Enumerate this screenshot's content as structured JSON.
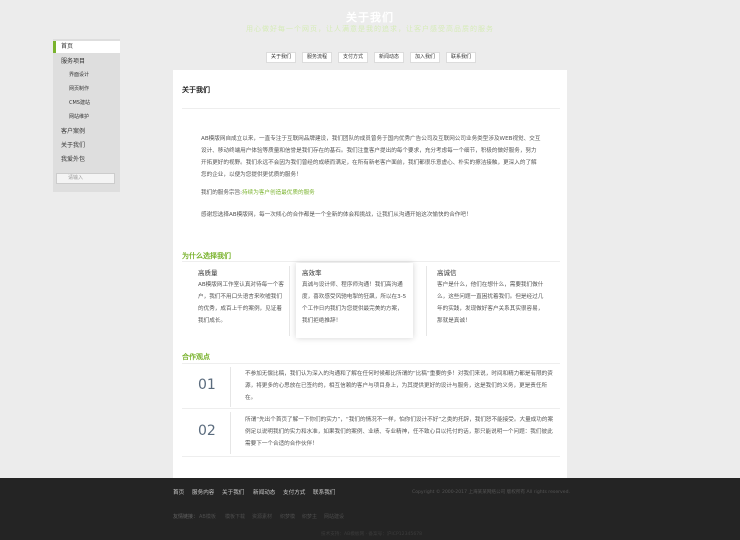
{
  "header": {
    "title": "关于我们",
    "tagline": "用心做好每一个网页，让人满意是我的追求，让客户感受高品质的服务"
  },
  "sidenav": {
    "items": [
      {
        "label": "首页",
        "active": true
      },
      {
        "label": "服务项目"
      },
      {
        "label": "界面设计",
        "sub": true
      },
      {
        "label": "网页制作",
        "sub": true
      },
      {
        "label": "CMS建站",
        "sub": true
      },
      {
        "label": "网站维护",
        "sub": true
      },
      {
        "label": "客户案例"
      },
      {
        "label": "关于我们"
      },
      {
        "label": "我爱外包"
      }
    ],
    "search_placeholder": "请输入"
  },
  "tabs": [
    "关于我们",
    "服务流程",
    "支付方式",
    "新闻动态",
    "加入我们",
    "联系我们"
  ],
  "card": {
    "title": "关于我们",
    "intro": "AB模版网自成立以来，一直专注于互联网品牌建设，我们团队的成员曾务于国内优秀广告公司及互联网公司业务类型涉及WEB视觉、交互设计、移动终端用户体验等质量和信誉是我们存在的基石。我们注重客户提出的每个要求，充分考虑每一个细节，积极的做好服务，努力开拓更好的视野。我们永远不会因为我们曾经的成绩而满足，在所有新老客户面前，我们都很乐意虚心、朴实的擦洁接触，更深入的了解您的企业，以便为您提供更优质的服务！",
    "mission_prefix": "我们的服务宗旨:",
    "mission_highlight": "持续为客户创造最优质的服务",
    "thanks": "感谢您选择AB模版网，每一次倾心的合作都是一个全新的体会和挑战，让我们从沟通开始这次愉快的合作吧！",
    "why_title": "为什么选择我们",
    "features": [
      {
        "title": "高质量",
        "text": "AB模版网工作室认真对待每一个客户，我们不用口头语言来吹嘘我们的优秀，成百上千的案例，见证着我们成长。"
      },
      {
        "title": "高效率",
        "text": "真诚与设计师、程序师沟通！我们高沟通度，喜欢感受风驰电掣的狂飙，所以在3-5个工作日内我们为您提供最完美的方案，我们拒绝推辞！"
      },
      {
        "title": "高诚信",
        "text": "客户是什么，他们在想什么，需要我们做什么，这些问题一直困扰着我们。但是经过几年的实践，发现做好客户关系其实很容易，那就是真诚！"
      }
    ],
    "views_title": "合作观点",
    "views": [
      {
        "num": "01",
        "text": "不参加无偿比稿，我们认为深入的沟通和了解在任何时候都比所谓的“比稿”重要的多！对我们来说，时间和精力都是有限的资源，将更多的心思放在已签约的，相互信赖的客户与项目身上，为其提供更好的设计与服务，这是我们的义务，更是责任所在。"
      },
      {
        "num": "02",
        "text": "所谓“先出个首页了解一下你们的实力”，“我们的情况不一样，怕你们设计不好”之类的托辞，我们恕不能接受。大量成功的案例足以说明我们的实力和水准，如果我们的案例、业绩、专业精神，任不致心目以托付的话，那只能说明一个问题：我们彼此需要下一个合适的合作伙伴！"
      }
    ]
  },
  "footer": {
    "links": [
      "首页",
      "服务内容",
      "关于我们",
      "新闻动态",
      "支付方式",
      "联系我们"
    ],
    "copyright": "Copyright © 2000-2017 上海某某网络公司 版权所有 All rights reserved.",
    "friend_label": "友情链接：",
    "friend_links": [
      "AB模板",
      "模板下载",
      "资源素材",
      "织梦模",
      "织梦主",
      "网站建设"
    ],
    "icp": "技术支持：AB模板网 · 备案号：沪ICP12345678"
  }
}
